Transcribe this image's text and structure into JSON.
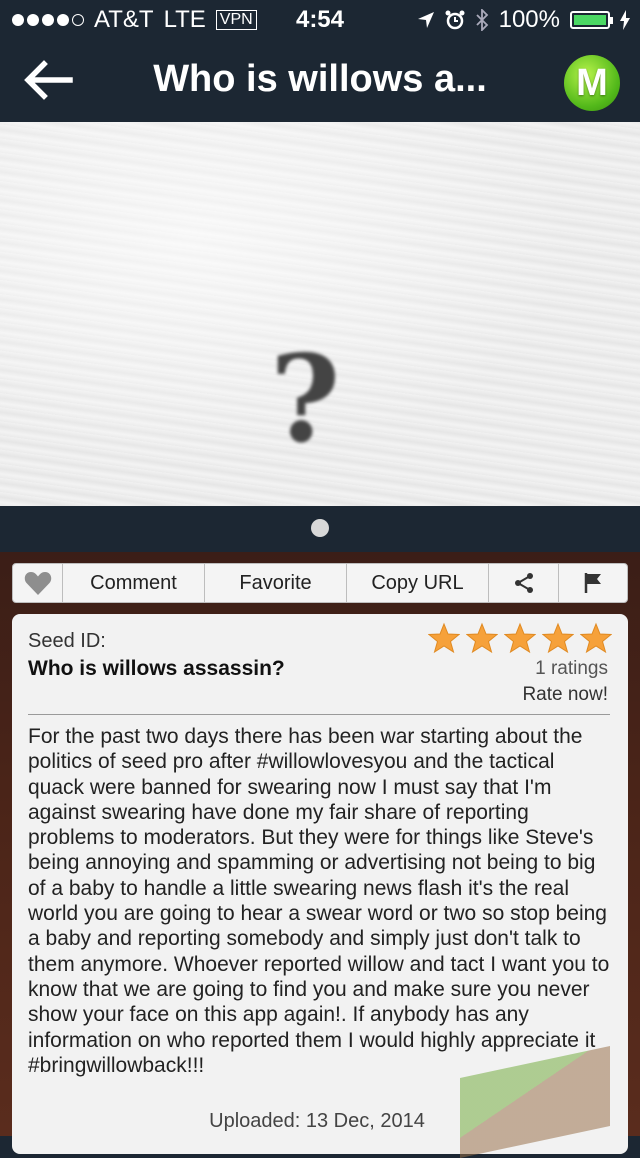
{
  "status_bar": {
    "carrier": "AT&T",
    "network": "LTE",
    "vpn": "VPN",
    "time": "4:54",
    "battery": "100%",
    "battery_level": 1.0,
    "signal_bars": 4
  },
  "nav": {
    "title": "Who is willows a...",
    "logo_letter": "M",
    "back_icon": "arrow-left-icon"
  },
  "hero": {
    "glyph": "?"
  },
  "actions": {
    "comment": "Comment",
    "favorite": "Favorite",
    "copy_url": "Copy URL"
  },
  "seed": {
    "id_label": "Seed ID:",
    "title": "Who is willows assassin?",
    "rating_stars": 5,
    "ratings": "1 ratings",
    "rate_now": "Rate now!",
    "description": "For the past two days there has been war starting about the politics of seed pro after #willowlovesyou and the tactical quack were banned for swearing now I must say that I'm against swearing have done my fair share of reporting problems to moderators. But they were for things like Steve's being annoying and spamming or advertising not being to big of a baby to handle a little swearing news flash it's the real world you are going to hear a swear word or two so stop being a baby and reporting somebody and simply just don't talk to them anymore. Whoever reported willow and tact I want you to know that we are going to find you and make sure you never show your face on this app again!. If anybody has any information on who reported them I would highly appreciate it #bringwillowback!!!",
    "uploaded": "Uploaded: 13 Dec, 2014"
  },
  "colors": {
    "nav_bg": "#1c2733",
    "star": "#f6a13a",
    "logo_green": "#52b81a"
  }
}
